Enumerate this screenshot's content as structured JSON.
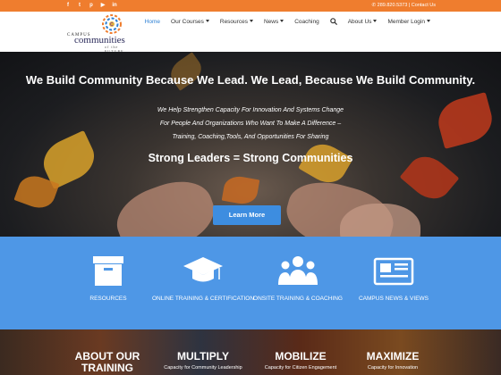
{
  "topbar": {
    "social_icons": [
      "facebook-icon",
      "twitter-icon",
      "pinterest-icon",
      "youtube-icon",
      "linkedin-icon"
    ],
    "social_glyphs": [
      "f",
      "t",
      "p",
      "▶",
      "in"
    ],
    "contact_text": "289.820.5373 | Contact Us"
  },
  "logo": {
    "top": "CAMPUS",
    "mid": "communities",
    "for": "for",
    "bottom": "of the FUTURE"
  },
  "nav": {
    "items": [
      {
        "label": "Home",
        "active": true,
        "dropdown": false
      },
      {
        "label": "Our Courses",
        "dropdown": true
      },
      {
        "label": "Resources",
        "dropdown": true
      },
      {
        "label": "News",
        "dropdown": true
      },
      {
        "label": "Coaching",
        "dropdown": false
      },
      {
        "label": "About Us",
        "dropdown": true
      },
      {
        "label": "Member Login",
        "dropdown": true
      }
    ],
    "search_icon": "search-icon"
  },
  "hero": {
    "headline": "We Build Community Because We Lead. We Lead, Because We Build Community.",
    "sub_line1": "We Help Strengthen Capacity For Innovation And Systems Change",
    "sub_line2": "For People And Organizations Who Want To Make A Difference –",
    "sub_line3": "Training, Coaching,Tools, And Opportunities For Sharing",
    "tagline": "Strong Leaders = Strong Communities",
    "button_label": "Learn More"
  },
  "services": [
    {
      "label": "RESOURCES",
      "icon": "archive-box-icon"
    },
    {
      "label": "ONLINE TRAINING & CERTIFICATION",
      "icon": "graduation-cap-icon"
    },
    {
      "label": "ONSITE TRAINING & COACHING",
      "icon": "group-icon"
    },
    {
      "label": "CAMPUS NEWS & VIEWS",
      "icon": "newspaper-icon"
    }
  ],
  "bottom": [
    {
      "title": "ABOUT OUR TRAINING",
      "subtitle": ""
    },
    {
      "title": "MULTIPLY",
      "subtitle": "Capacity for Community Leadership"
    },
    {
      "title": "MOBILIZE",
      "subtitle": "Capacity for Citizen Engagement"
    },
    {
      "title": "MAXIMIZE",
      "subtitle": "Capacity for Innovation"
    }
  ],
  "colors": {
    "topbar": "#ef7d2e",
    "accent": "#2b7fd4",
    "services_bg": "#4e97e6",
    "button": "#3d8de0"
  }
}
